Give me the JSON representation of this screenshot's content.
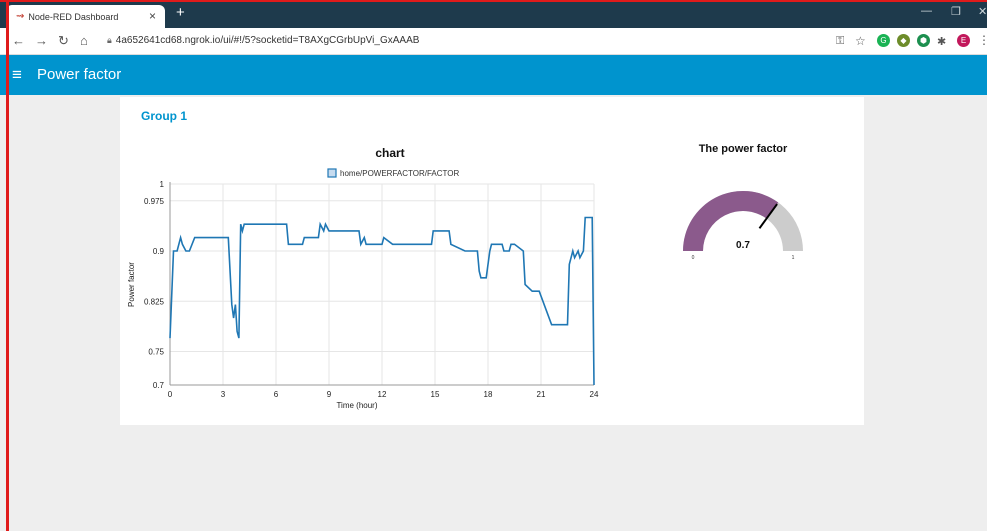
{
  "browser": {
    "tab_title": "Node-RED Dashboard",
    "tab_close": "×",
    "new_tab": "+",
    "url": "4a652641cd68.ngrok.io/ui/#!/5?socketid=T8AXgCGrbUpVi_GxAAAB",
    "profile_initial": "E"
  },
  "toolbar": {
    "title": "Power factor"
  },
  "group": {
    "title": "Group 1"
  },
  "chart": {
    "title": "chart"
  },
  "chart_data": {
    "type": "line",
    "title": "chart",
    "xlabel": "Time (hour)",
    "ylabel": "Power factor",
    "xlim": [
      0,
      24
    ],
    "ylim": [
      0.7,
      1.0
    ],
    "xticks": [
      "0",
      "3",
      "6",
      "9",
      "12",
      "15",
      "18",
      "21",
      "24"
    ],
    "yticks": [
      "0.7",
      "0.75",
      "0.825",
      "0.9",
      "0.975",
      "1"
    ],
    "grid": true,
    "legend": "top",
    "series": [
      {
        "name": "home/POWERFACTOR/FACTOR",
        "color": "#1f77b4",
        "x": [
          0,
          0.2,
          0.4,
          0.6,
          0.7,
          0.9,
          1.1,
          1.4,
          1.5,
          3.3,
          3.5,
          3.6,
          3.7,
          3.8,
          3.9,
          4.0,
          4.1,
          4.2,
          6.6,
          6.7,
          7.5,
          7.6,
          8.4,
          8.5,
          8.7,
          8.8,
          9.0,
          9.2,
          9.4,
          10.7,
          10.8,
          11.0,
          11.1,
          11.4,
          11.5,
          12.0,
          12.1,
          12.6,
          12.7,
          13.8,
          13.9,
          14.8,
          14.9,
          15.8,
          15.9,
          16.7,
          16.8,
          17.4,
          17.5,
          17.6,
          17.7,
          17.9,
          18.1,
          18.2,
          18.8,
          18.9,
          19.1,
          19.2,
          19.3,
          19.4,
          19.5,
          20.0,
          20.1,
          20.5,
          20.6,
          20.8,
          20.9,
          21.6,
          21.7,
          22.5,
          22.6,
          22.8,
          22.9,
          23.1,
          23.2,
          23.4,
          23.5,
          23.9,
          24.0
        ],
        "y": [
          0.77,
          0.9,
          0.9,
          0.92,
          0.91,
          0.9,
          0.9,
          0.92,
          0.92,
          0.92,
          0.82,
          0.8,
          0.82,
          0.78,
          0.77,
          0.94,
          0.93,
          0.94,
          0.94,
          0.91,
          0.91,
          0.92,
          0.92,
          0.94,
          0.93,
          0.94,
          0.93,
          0.93,
          0.93,
          0.93,
          0.91,
          0.92,
          0.91,
          0.91,
          0.91,
          0.91,
          0.92,
          0.91,
          0.91,
          0.91,
          0.91,
          0.91,
          0.93,
          0.93,
          0.91,
          0.9,
          0.9,
          0.9,
          0.87,
          0.86,
          0.86,
          0.86,
          0.9,
          0.91,
          0.91,
          0.9,
          0.9,
          0.9,
          0.91,
          0.91,
          0.91,
          0.9,
          0.85,
          0.84,
          0.84,
          0.84,
          0.84,
          0.79,
          0.79,
          0.79,
          0.88,
          0.9,
          0.89,
          0.9,
          0.89,
          0.9,
          0.95,
          0.95,
          0.7
        ]
      }
    ]
  },
  "gauge": {
    "title": "The power factor",
    "value": 0.7,
    "value_label": "0.7",
    "min_label": "0",
    "max_label": "1",
    "min": 0,
    "max": 1,
    "fill_color": "#8b5a8c",
    "track_color": "#cccccc",
    "needle_color": "#000000"
  }
}
